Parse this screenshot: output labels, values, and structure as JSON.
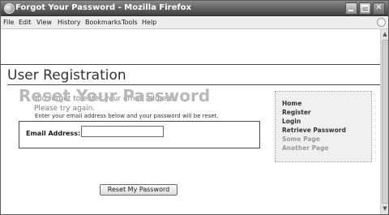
{
  "window": {
    "title": "Forgot Your Password - Mozilla Firefox",
    "controls": [
      "minimize",
      "maximize",
      "close"
    ]
  },
  "menubar": {
    "items": [
      "File",
      "Edit",
      "View",
      "History",
      "Bookmarks",
      "Tools",
      "Help"
    ]
  },
  "page": {
    "header_title": "User Registration",
    "error_line1": "You forgot to enter your email address!",
    "error_line2": "Please try again.",
    "heading": "Reset Your Password",
    "instructions": "Enter your email address below and your password will be reset.",
    "email_label": "Email Address:",
    "email_value": "",
    "submit_label": "Reset My Password"
  },
  "sidebar": {
    "links": [
      "Home",
      "Register",
      "Login",
      "Retrieve Password",
      "Some Page",
      "Another Page"
    ]
  },
  "colors": {
    "titlebar": "#3e3e3e",
    "heading": "#b9b9b9",
    "error_text": "#7f7f7f",
    "sidebar_bg": "#f0f0f0"
  },
  "icons": {
    "app": "firefox-icon",
    "activity": "throbber-icon"
  }
}
